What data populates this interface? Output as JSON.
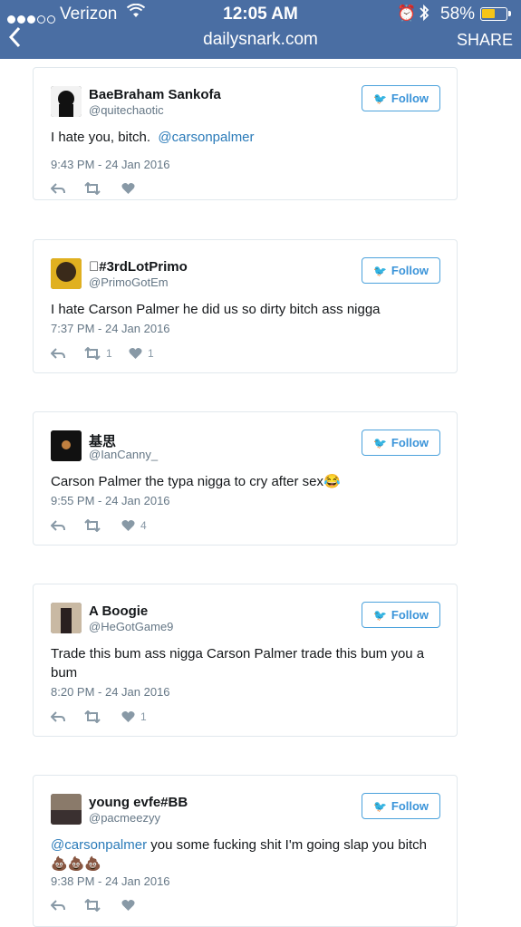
{
  "statusbar": {
    "carrier": "Verizon",
    "time": "12:05 AM",
    "battery_percent": "58%",
    "battery_level": 0.58,
    "icons": [
      "signal-dots",
      "wifi-icon",
      "alarm-icon",
      "bluetooth-icon",
      "battery-icon"
    ]
  },
  "navbar": {
    "back": "<",
    "url": "dailysnark.com",
    "share": "SHARE"
  },
  "follow_label": "Follow",
  "tweets": [
    {
      "name": "BaeBraham Sankofa",
      "handle": "@quitechaotic",
      "text": "I hate you, bitch.",
      "mention": "@carsonpalmer",
      "date": "9:43 PM - 24 Jan 2016",
      "retweets": "",
      "likes": ""
    },
    {
      "name": "\u0000#3rdLotPrimo",
      "handle": "@PrimoGotEm",
      "text": "I hate Carson Palmer he did us so dirty bitch ass nigga",
      "date": "7:37 PM - 24 Jan 2016",
      "retweets": "1",
      "likes": "1"
    },
    {
      "name": "基思",
      "handle": "@IanCanny_",
      "text": "Carson Palmer the typa nigga to cry after sex😂",
      "date": "9:55 PM - 24 Jan 2016",
      "retweets": "",
      "likes": "4"
    },
    {
      "name": "A Boogie",
      "handle": "@HeGotGame9",
      "text": "Trade this bum ass nigga Carson Palmer trade this bum you a bum",
      "date": "8:20 PM - 24 Jan 2016",
      "retweets": "",
      "likes": "1"
    },
    {
      "name": "young evfe#BB",
      "handle": "@pacmeezyy",
      "mention": "@carsonpalmer",
      "text": " you some fucking shit I'm going slap you bitch 💩💩💩",
      "date": "9:38 PM - 24 Jan 2016",
      "retweets": "",
      "likes": ""
    }
  ]
}
